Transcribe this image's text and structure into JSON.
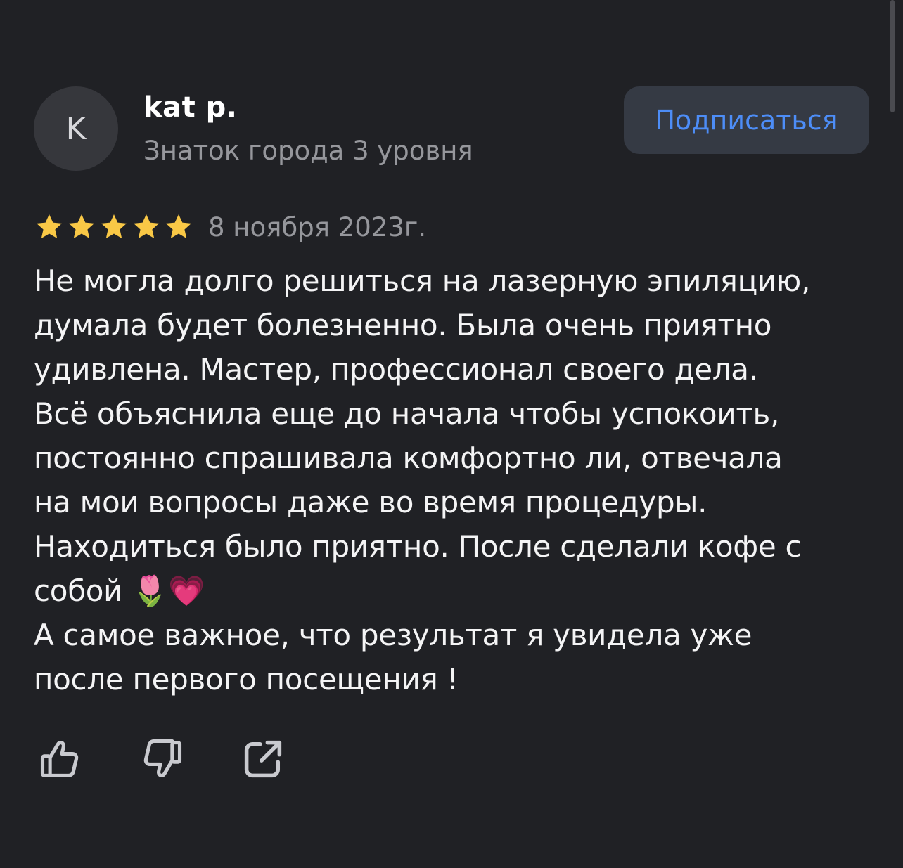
{
  "author": {
    "avatar_letter": "K",
    "name": "kat p.",
    "level": "Знаток города 3 уровня"
  },
  "subscribe": {
    "label": "Подписаться"
  },
  "review": {
    "rating": 5,
    "rating_max": 5,
    "date": "8 ноября 2023г.",
    "text": "Не могла долго решиться на лазерную эпиляцию,\nдумала будет болезненно. Была очень приятно\nудивлена. Мастер, профессионал своего дела.\nВсё объяснила еще до начала чтобы успокоить,\nпостоянно спрашивала комфортно ли, отвечала\nна мои вопросы даже во время процедуры.\nНаходиться было приятно. После сделали кофе с\nсобой 🌷💗\nА самое важное, что результат я увидела уже\nпосле первого посещения !"
  },
  "actions": {
    "like_icon": "thumbs-up-icon",
    "dislike_icon": "thumbs-down-icon",
    "share_icon": "share-icon"
  },
  "colors": {
    "background": "#202125",
    "accent": "#4d8df7",
    "star": "#f9c846",
    "secondary_text": "#96979c"
  }
}
